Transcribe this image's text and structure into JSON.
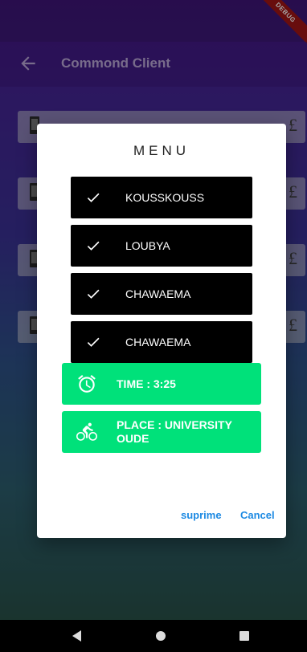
{
  "debug_banner": "DEBUG",
  "app_bar": {
    "title": "Commond Client"
  },
  "background_cards": [
    {
      "currency": "£"
    },
    {
      "currency": "£"
    },
    {
      "currency": "£"
    },
    {
      "currency": "£"
    }
  ],
  "dialog": {
    "title": "MENU",
    "items": [
      {
        "label": "KOUSSKOUSS",
        "checked": true
      },
      {
        "label": "LOUBYA",
        "checked": true
      },
      {
        "label": "CHAWAEMA",
        "checked": true
      },
      {
        "label": "CHAWAEMA",
        "checked": true
      }
    ],
    "time": {
      "label": "TIME : 3:25",
      "icon": "alarm-icon"
    },
    "place": {
      "label": "PLACE : UNIVERSITY OUDE",
      "icon": "bicycle-icon"
    },
    "actions": {
      "suprime": "suprime",
      "cancel": "Cancel"
    }
  },
  "colors": {
    "accent_green": "#00e17a",
    "button_blue": "#1d8ae3",
    "item_black": "#000000"
  }
}
